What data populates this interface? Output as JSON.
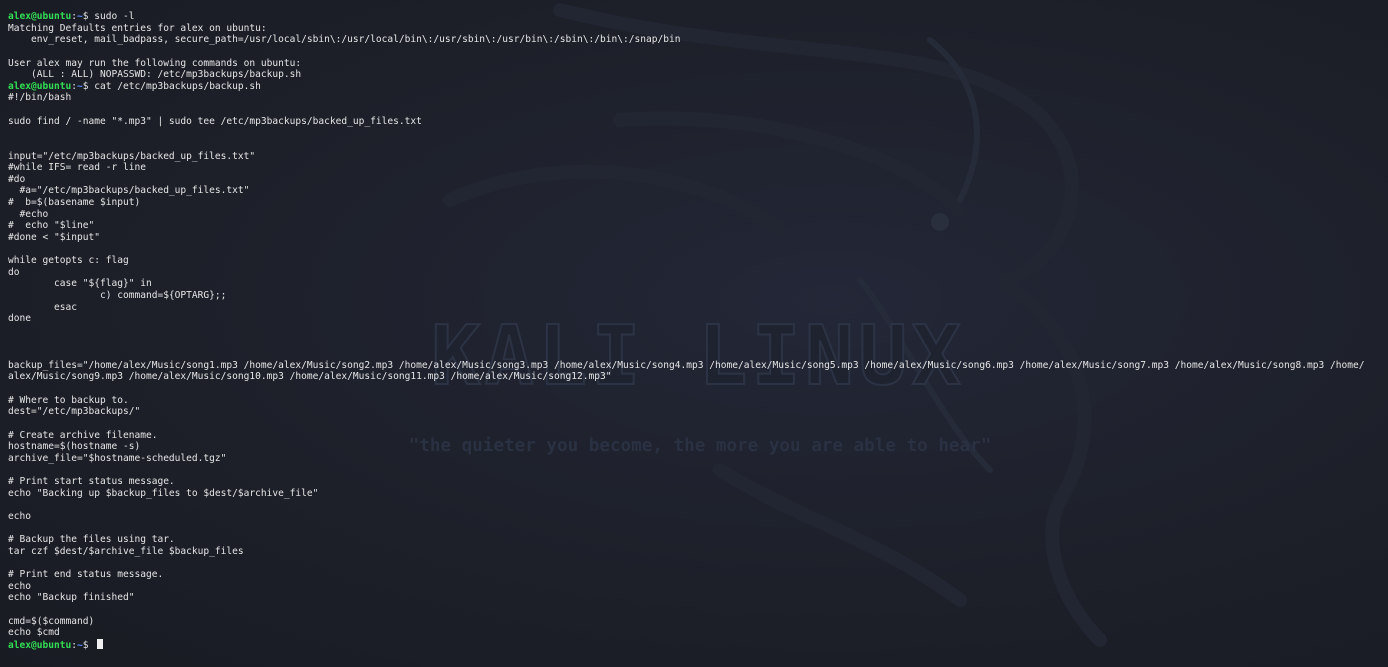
{
  "wallpaper": {
    "brand": "KALI LINUX",
    "tagline": "\"the quieter you become, the more you are able to hear\""
  },
  "colors": {
    "background": "#1c1f2a",
    "text": "#e6e6e6",
    "prompt_user": "#33dd55",
    "prompt_path": "#5b8cff"
  },
  "prompt": {
    "user_host": "alex@ubuntu",
    "sep": ":",
    "path": "~",
    "symbol": "$ "
  },
  "terminal": {
    "lines": [
      {
        "kind": "prompt",
        "cmd": "sudo -l"
      },
      {
        "kind": "text",
        "text": "Matching Defaults entries for alex on ubuntu:"
      },
      {
        "kind": "text",
        "text": "    env_reset, mail_badpass, secure_path=/usr/local/sbin\\:/usr/local/bin\\:/usr/sbin\\:/usr/bin\\:/sbin\\:/bin\\:/snap/bin"
      },
      {
        "kind": "text",
        "text": ""
      },
      {
        "kind": "text",
        "text": "User alex may run the following commands on ubuntu:"
      },
      {
        "kind": "text",
        "text": "    (ALL : ALL) NOPASSWD: /etc/mp3backups/backup.sh"
      },
      {
        "kind": "prompt",
        "cmd": "cat /etc/mp3backups/backup.sh"
      },
      {
        "kind": "text",
        "text": "#!/bin/bash"
      },
      {
        "kind": "text",
        "text": ""
      },
      {
        "kind": "text",
        "text": "sudo find / -name \"*.mp3\" | sudo tee /etc/mp3backups/backed_up_files.txt"
      },
      {
        "kind": "text",
        "text": ""
      },
      {
        "kind": "text",
        "text": ""
      },
      {
        "kind": "text",
        "text": "input=\"/etc/mp3backups/backed_up_files.txt\""
      },
      {
        "kind": "text",
        "text": "#while IFS= read -r line"
      },
      {
        "kind": "text",
        "text": "#do"
      },
      {
        "kind": "text",
        "text": "  #a=\"/etc/mp3backups/backed_up_files.txt\""
      },
      {
        "kind": "text",
        "text": "#  b=$(basename $input)"
      },
      {
        "kind": "text",
        "text": "  #echo"
      },
      {
        "kind": "text",
        "text": "#  echo \"$line\""
      },
      {
        "kind": "text",
        "text": "#done < \"$input\""
      },
      {
        "kind": "text",
        "text": ""
      },
      {
        "kind": "text",
        "text": "while getopts c: flag"
      },
      {
        "kind": "text",
        "text": "do"
      },
      {
        "kind": "text",
        "text": "        case \"${flag}\" in"
      },
      {
        "kind": "text",
        "text": "                c) command=${OPTARG};;"
      },
      {
        "kind": "text",
        "text": "        esac"
      },
      {
        "kind": "text",
        "text": "done"
      },
      {
        "kind": "text",
        "text": ""
      },
      {
        "kind": "text",
        "text": ""
      },
      {
        "kind": "text",
        "text": ""
      },
      {
        "kind": "text",
        "text": "backup_files=\"/home/alex/Music/song1.mp3 /home/alex/Music/song2.mp3 /home/alex/Music/song3.mp3 /home/alex/Music/song4.mp3 /home/alex/Music/song5.mp3 /home/alex/Music/song6.mp3 /home/alex/Music/song7.mp3 /home/alex/Music/song8.mp3 /home/"
      },
      {
        "kind": "text",
        "text": "alex/Music/song9.mp3 /home/alex/Music/song10.mp3 /home/alex/Music/song11.mp3 /home/alex/Music/song12.mp3\""
      },
      {
        "kind": "text",
        "text": ""
      },
      {
        "kind": "text",
        "text": "# Where to backup to."
      },
      {
        "kind": "text",
        "text": "dest=\"/etc/mp3backups/\""
      },
      {
        "kind": "text",
        "text": ""
      },
      {
        "kind": "text",
        "text": "# Create archive filename."
      },
      {
        "kind": "text",
        "text": "hostname=$(hostname -s)"
      },
      {
        "kind": "text",
        "text": "archive_file=\"$hostname-scheduled.tgz\""
      },
      {
        "kind": "text",
        "text": ""
      },
      {
        "kind": "text",
        "text": "# Print start status message."
      },
      {
        "kind": "text",
        "text": "echo \"Backing up $backup_files to $dest/$archive_file\""
      },
      {
        "kind": "text",
        "text": ""
      },
      {
        "kind": "text",
        "text": "echo"
      },
      {
        "kind": "text",
        "text": ""
      },
      {
        "kind": "text",
        "text": "# Backup the files using tar."
      },
      {
        "kind": "text",
        "text": "tar czf $dest/$archive_file $backup_files"
      },
      {
        "kind": "text",
        "text": ""
      },
      {
        "kind": "text",
        "text": "# Print end status message."
      },
      {
        "kind": "text",
        "text": "echo"
      },
      {
        "kind": "text",
        "text": "echo \"Backup finished\""
      },
      {
        "kind": "text",
        "text": ""
      },
      {
        "kind": "text",
        "text": "cmd=$($command)"
      },
      {
        "kind": "text",
        "text": "echo $cmd"
      },
      {
        "kind": "prompt",
        "cmd": "",
        "cursor": true
      }
    ]
  }
}
